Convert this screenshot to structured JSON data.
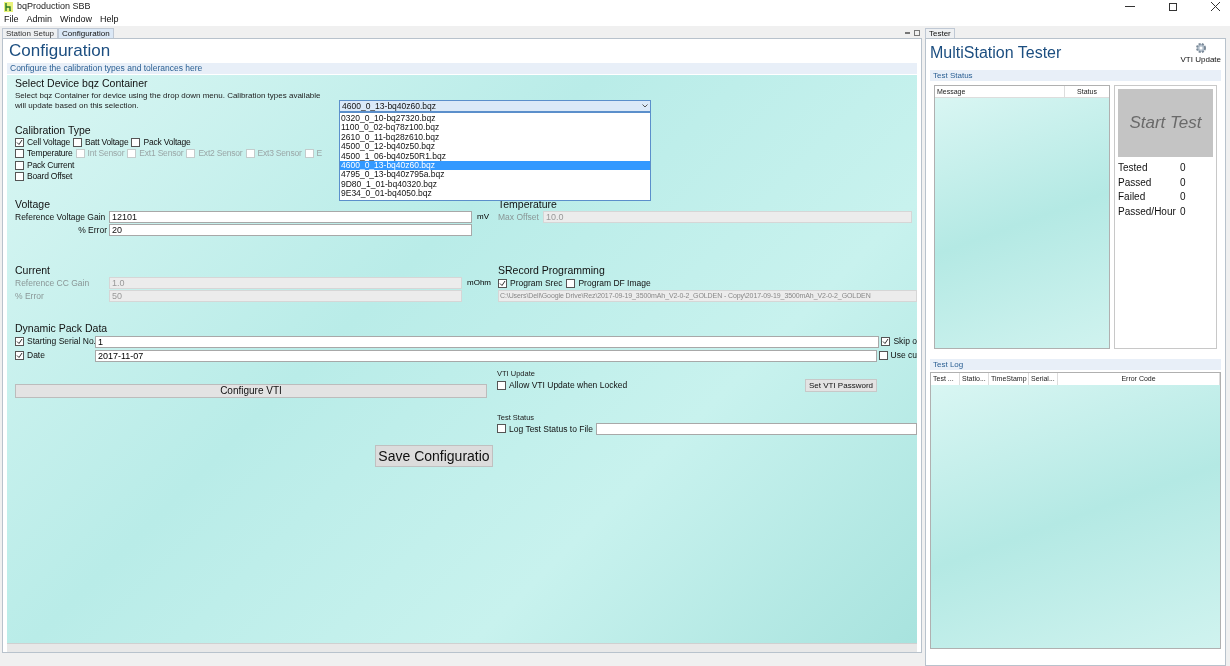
{
  "window": {
    "title": "bqProduction SBB"
  },
  "menu": [
    "File",
    "Admin",
    "Window",
    "Help"
  ],
  "left_tabs": [
    {
      "label": "Station Setup",
      "selected": false
    },
    {
      "label": "Configuration",
      "selected": true
    }
  ],
  "configuration": {
    "title": "Configuration",
    "subtitle": "Configure the calibration types and tolerances here",
    "device": {
      "heading": "Select Device bqz Container",
      "description": "Select bqz Container for device using the drop down menu.  Calibration types available will update based on this selection.",
      "value": "4600_0_13-bq40z60.bqz",
      "expanded": true,
      "options": [
        {
          "label": "0320_0_10-bq27320.bqz",
          "selected": false
        },
        {
          "label": "1100_0_02-bq78z100.bqz",
          "selected": false
        },
        {
          "label": "2610_0_11-bq28z610.bqz",
          "selected": false
        },
        {
          "label": "4500_0_12-bq40z50.bqz",
          "selected": false
        },
        {
          "label": "4500_1_06-bq40z50R1.bqz",
          "selected": false
        },
        {
          "label": "4600_0_13-bq40z60.bqz",
          "selected": true
        },
        {
          "label": "4795_0_13-bq40z795a.bqz",
          "selected": false
        },
        {
          "label": "9D80_1_01-bq40320.bqz",
          "selected": false
        },
        {
          "label": "9E34_0_01-bq4050.bqz",
          "selected": false
        }
      ]
    },
    "calibration": {
      "heading": "Calibration Type",
      "rows": [
        [
          {
            "label": "Cell Voltage",
            "checked": true,
            "disabled": false
          },
          {
            "label": "Batt Voltage",
            "checked": false,
            "disabled": false
          },
          {
            "label": "Pack Voltage",
            "checked": false,
            "disabled": false
          }
        ],
        [
          {
            "label": "Temperature",
            "checked": false,
            "disabled": false
          },
          {
            "label": "Int Sensor",
            "checked": false,
            "disabled": true
          },
          {
            "label": "Ext1 Sensor",
            "checked": false,
            "disabled": true
          },
          {
            "label": "Ext2 Sensor",
            "checked": false,
            "disabled": true
          },
          {
            "label": "Ext3 Sensor",
            "checked": false,
            "disabled": true
          },
          {
            "label": "E",
            "checked": false,
            "disabled": true
          }
        ],
        [
          {
            "label": "Pack Current",
            "checked": false,
            "disabled": false
          }
        ],
        [
          {
            "label": "Board Offset",
            "checked": false,
            "disabled": false
          }
        ]
      ]
    },
    "voltage": {
      "heading": "Voltage",
      "fields": [
        {
          "label": "Reference Voltage Gain",
          "value": "12101",
          "unit": "mV",
          "disabled": false
        },
        {
          "label": "% Error",
          "value": "20",
          "disabled": false
        }
      ]
    },
    "temperature": {
      "heading": "Temperature",
      "fields": [
        {
          "label": "Max Offset",
          "value": "10.0",
          "disabled": true
        }
      ]
    },
    "current": {
      "heading": "Current",
      "fields": [
        {
          "label": "Reference CC Gain",
          "value": "1.0",
          "unit": "mOhm",
          "disabled": true
        },
        {
          "label": "% Error",
          "value": "50",
          "disabled": true
        }
      ]
    },
    "srecord": {
      "heading": "SRecord Programming",
      "options": [
        {
          "label": "Program Srec",
          "checked": true
        },
        {
          "label": "Program DF Image",
          "checked": false
        }
      ],
      "path": "C:\\Users\\Dell\\Google Drive\\Rez\\2017-09-19_3500mAh_V2-0-2_GOLDEN - Copy\\2017-09-19_3500mAh_V2-0-2_GOLDEN"
    },
    "dynamic": {
      "heading": "Dynamic Pack Data",
      "rows": [
        {
          "label": "Starting Serial No.",
          "checked": true,
          "value": "1",
          "option": {
            "label": "Skip o",
            "checked": true
          }
        },
        {
          "label": "Date",
          "checked": true,
          "value": "2017-11-07",
          "option": {
            "label": "Use cu",
            "checked": false
          }
        }
      ]
    },
    "configure_vti": "Configure VTI",
    "vti_update": {
      "heading": "VTI Update",
      "option": {
        "label": "Allow VTI Update when Locked",
        "checked": false
      },
      "button": "Set VTI Password"
    },
    "test_status": {
      "heading": "Test Status",
      "option": {
        "label": "Log Test Status to File",
        "checked": false
      }
    },
    "save_button": "Save Configuratio"
  },
  "tester": {
    "tab": "Tester",
    "title": "MultiStation Tester",
    "vti_update": "VTI Update",
    "status_heading": "Test Status",
    "status_columns": [
      "Message",
      "Status"
    ],
    "start_button": "Start Test",
    "stats": [
      {
        "label": "Tested",
        "value": "0"
      },
      {
        "label": "Passed",
        "value": "0"
      },
      {
        "label": "Failed",
        "value": "0"
      },
      {
        "label": "Passed/Hour",
        "value": "0"
      }
    ],
    "log_heading": "Test Log",
    "log_columns": [
      "Test ...",
      "Statio...",
      "TimeStamp",
      "Serial...",
      "Error Code"
    ]
  }
}
